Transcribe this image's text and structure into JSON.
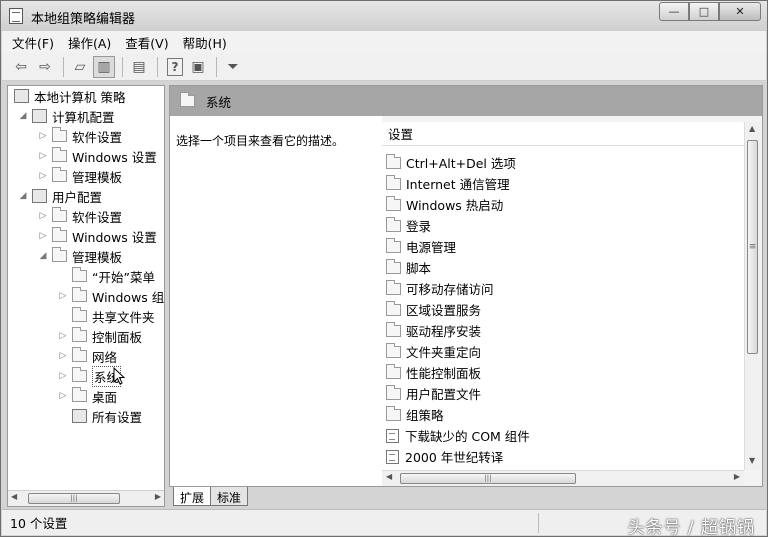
{
  "window": {
    "title": "本地组策略编辑器",
    "buttons": {
      "minimize": "—",
      "maximize": "□",
      "close": "✕"
    }
  },
  "menu": [
    "文件(F)",
    "操作(A)",
    "查看(V)",
    "帮助(H)"
  ],
  "toolbar": {
    "icons": [
      "back-icon",
      "forward-icon",
      "up-folder-icon",
      "show-hide-tree-icon",
      "export-list-icon",
      "help-icon",
      "properties-icon",
      "filter-icon"
    ]
  },
  "tree": {
    "root": "本地计算机 策略",
    "computer_config": "计算机配置",
    "computer_software": "软件设置",
    "computer_windows": "Windows 设置",
    "computer_admin": "管理模板",
    "user_config": "用户配置",
    "user_software": "软件设置",
    "user_windows": "Windows 设置",
    "user_admin": "管理模板",
    "start_menu": "“开始”菜单",
    "windows_components": "Windows 组件",
    "shared_folders": "共享文件夹",
    "control_panel": "控制面板",
    "network": "网络",
    "system": "系统",
    "desktop": "桌面",
    "all_settings": "所有设置"
  },
  "right": {
    "header": "系统",
    "description": "选择一个项目来查看它的描述。",
    "column_header": "设置",
    "items": [
      {
        "label": "Ctrl+Alt+Del 选项",
        "icon": "folder"
      },
      {
        "label": "Internet 通信管理",
        "icon": "folder"
      },
      {
        "label": "Windows 热启动",
        "icon": "folder"
      },
      {
        "label": "登录",
        "icon": "folder"
      },
      {
        "label": "电源管理",
        "icon": "folder"
      },
      {
        "label": "脚本",
        "icon": "folder"
      },
      {
        "label": "可移动存储访问",
        "icon": "folder"
      },
      {
        "label": "区域设置服务",
        "icon": "folder"
      },
      {
        "label": "驱动程序安装",
        "icon": "folder"
      },
      {
        "label": "文件夹重定向",
        "icon": "folder"
      },
      {
        "label": "性能控制面板",
        "icon": "folder"
      },
      {
        "label": "用户配置文件",
        "icon": "folder"
      },
      {
        "label": "组策略",
        "icon": "folder"
      },
      {
        "label": "下载缺少的 COM 组件",
        "icon": "policy"
      },
      {
        "label": "2000 年世纪转译",
        "icon": "policy"
      }
    ]
  },
  "tabs": [
    "扩展",
    "标准"
  ],
  "status": "10 个设置",
  "watermark": "头条号 / 超锅锅"
}
